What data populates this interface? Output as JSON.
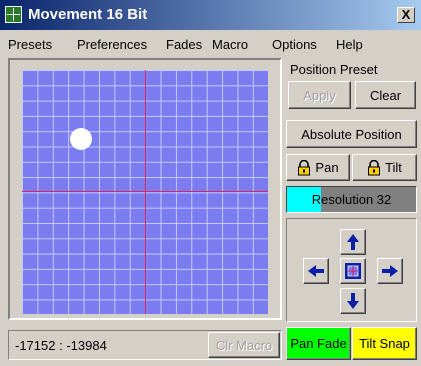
{
  "window": {
    "title": "Movement 16 Bit",
    "close_label": "X"
  },
  "menu": {
    "items": [
      "Presets",
      "Preferences",
      "Fades",
      "Macro",
      "Options",
      "Help"
    ]
  },
  "position_preset": {
    "label": "Position Preset",
    "apply_label": "Apply",
    "clear_label": "Clear"
  },
  "absolute_position_label": "Absolute Position",
  "lock": {
    "pan_label": "Pan",
    "tilt_label": "Tilt"
  },
  "resolution": {
    "label": "Resolution 32",
    "fill_fraction": 0.26,
    "fill_color": "#00ffff"
  },
  "status": {
    "position_text": "-17152 : -13984",
    "clear_macro_label": "Clr Macro"
  },
  "fade": {
    "pan_fade_label": "Pan Fade",
    "pan_fade_color": "#00ff00",
    "tilt_snap_label": "Tilt Snap",
    "tilt_snap_color": "#ffff00"
  },
  "icons": {
    "title": "move-cross-icon",
    "lock": "padlock-icon",
    "up": "arrow-up-icon",
    "down": "arrow-down-icon",
    "left": "arrow-left-icon",
    "right": "arrow-right-icon",
    "center": "center-target-icon"
  },
  "colors": {
    "pad_background": "#7a7cf0",
    "grid_lines": "#c7c9ff",
    "crosshair": "#e0205a",
    "arrow": "#0b1fa8"
  }
}
